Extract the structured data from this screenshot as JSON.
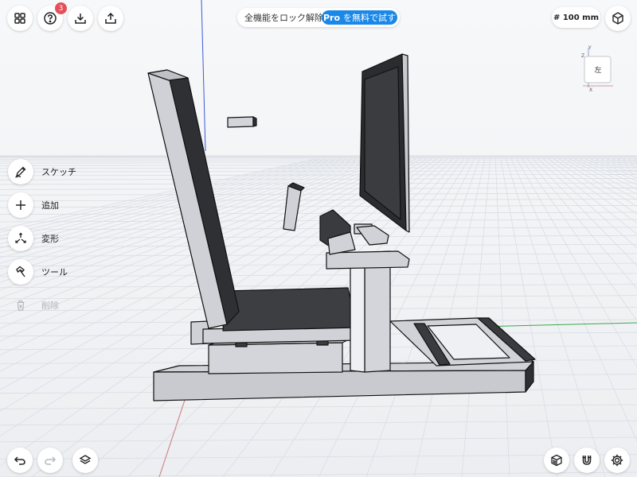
{
  "top_left": {
    "help_badge": "3"
  },
  "promo": {
    "text": "全機能をロック解除",
    "pill_brand": "Pro",
    "pill_text": "を無料で試す"
  },
  "grid_size": {
    "label": "# 100 mm"
  },
  "view_cube": {
    "face_label": "左",
    "axis_labels": {
      "y": "Y",
      "x": "X",
      "z": "Z"
    }
  },
  "tools": [
    {
      "label": "スケッチ",
      "icon": "sketch-pen-icon",
      "enabled": true
    },
    {
      "label": "追加",
      "icon": "plus-icon",
      "enabled": true
    },
    {
      "label": "変形",
      "icon": "transform-arrows-icon",
      "enabled": true
    },
    {
      "label": "ツール",
      "icon": "hammer-icon",
      "enabled": true
    },
    {
      "label": "削除",
      "icon": "trash-icon",
      "enabled": false
    }
  ],
  "bottom_left": [
    "undo-icon",
    "redo-icon",
    "layers-icon"
  ],
  "bottom_right": [
    "material-icon",
    "snap-magnet-icon",
    "settings-gear-icon"
  ],
  "colors": {
    "background": "#f1f2f5",
    "grid": "#d7dbe1",
    "accent": "#1a88e8",
    "model_light": "#cfd1d6",
    "model_dark": "#3a3b3f",
    "badge": "#e4505a"
  }
}
